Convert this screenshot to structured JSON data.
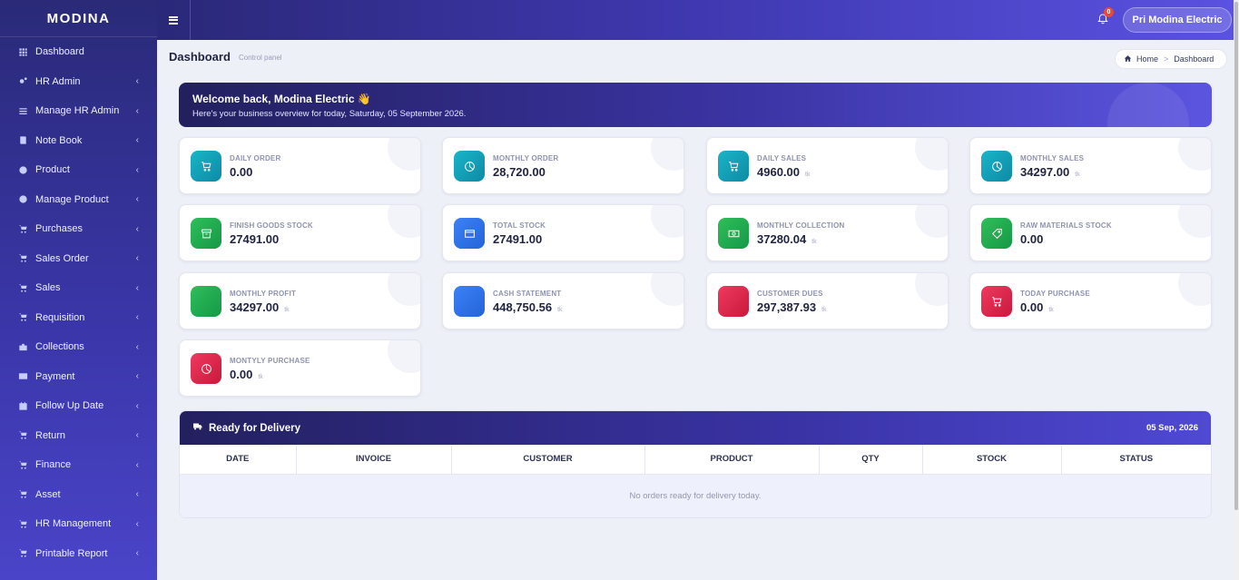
{
  "brand": "MODINA",
  "sidebar": {
    "items": [
      {
        "label": "Dashboard",
        "icon": "grid-icon",
        "chevron": false
      },
      {
        "label": "HR Admin",
        "icon": "cogs-icon",
        "chevron": true
      },
      {
        "label": "Manage HR Admin",
        "icon": "list-icon",
        "chevron": true
      },
      {
        "label": "Note Book",
        "icon": "book-icon",
        "chevron": true
      },
      {
        "label": "Product",
        "icon": "product-icon",
        "chevron": true
      },
      {
        "label": "Manage Product",
        "icon": "product-icon",
        "chevron": true
      },
      {
        "label": "Purchases",
        "icon": "cart-icon",
        "chevron": true
      },
      {
        "label": "Sales Order",
        "icon": "cart-icon",
        "chevron": true
      },
      {
        "label": "Sales",
        "icon": "cart-icon",
        "chevron": true
      },
      {
        "label": "Requisition",
        "icon": "cart-icon",
        "chevron": true
      },
      {
        "label": "Collections",
        "icon": "briefcase-icon",
        "chevron": true
      },
      {
        "label": "Payment",
        "icon": "credit-card-icon",
        "chevron": true
      },
      {
        "label": "Follow Up Date",
        "icon": "calendar-icon",
        "chevron": true
      },
      {
        "label": "Return",
        "icon": "cart-icon",
        "chevron": true
      },
      {
        "label": "Finance",
        "icon": "cart-icon",
        "chevron": true
      },
      {
        "label": "Asset",
        "icon": "cart-icon",
        "chevron": true
      },
      {
        "label": "HR Management",
        "icon": "cart-icon",
        "chevron": true
      },
      {
        "label": "Printable Report",
        "icon": "cart-icon",
        "chevron": true
      }
    ],
    "chevron_glyph": "‹"
  },
  "topbar": {
    "notification_count": "0",
    "user_label": "Pri Modina Electric"
  },
  "header": {
    "title": "Dashboard",
    "subtitle": "Control panel",
    "breadcrumb_home": "Home",
    "breadcrumb_sep": ">",
    "breadcrumb_current": "Dashboard"
  },
  "welcome": {
    "title": "Welcome back, Modina Electric 👋",
    "subtitle": "Here's your business overview for today, Saturday, 05 September 2026."
  },
  "stats": [
    {
      "label": "DAILY ORDER",
      "value": "0.00",
      "unit": "",
      "color": "teal",
      "icon": "cart-icon"
    },
    {
      "label": "MONTHLY ORDER",
      "value": "28,720.00",
      "unit": "",
      "color": "teal",
      "icon": "pie-icon"
    },
    {
      "label": "DAILY SALES",
      "value": "4960.00",
      "unit": "tk",
      "color": "teal",
      "icon": "cart-icon"
    },
    {
      "label": "MONTHLY SALES",
      "value": "34297.00",
      "unit": "tk",
      "color": "teal",
      "icon": "pie-icon"
    },
    {
      "label": "FINISH GOODS STOCK",
      "value": "27491.00",
      "unit": "",
      "color": "green",
      "icon": "archive-icon"
    },
    {
      "label": "TOTAL STOCK",
      "value": "27491.00",
      "unit": "",
      "color": "blue",
      "icon": "box-icon"
    },
    {
      "label": "MONTHLY COLLECTION",
      "value": "37280.04",
      "unit": "tk",
      "color": "green",
      "icon": "money-icon"
    },
    {
      "label": "RAW MATERIALS STOCK",
      "value": "0.00",
      "unit": "",
      "color": "green",
      "icon": "tag-icon"
    },
    {
      "label": "MONTHLY PROFIT",
      "value": "34297.00",
      "unit": "tk",
      "color": "green",
      "icon": ""
    },
    {
      "label": "CASH STATEMENT",
      "value": "448,750.56",
      "unit": "tk",
      "color": "blue",
      "icon": ""
    },
    {
      "label": "CUSTOMER DUES",
      "value": "297,387.93",
      "unit": "tk",
      "color": "red",
      "icon": ""
    },
    {
      "label": "TODAY PURCHASE",
      "value": "0.00",
      "unit": "tk",
      "color": "red",
      "icon": "cart-icon"
    },
    {
      "label": "MONTYLY PURCHASE",
      "value": "0.00",
      "unit": "tk",
      "color": "red",
      "icon": "pie-icon"
    }
  ],
  "delivery": {
    "title": "Ready for Delivery",
    "date": "05 Sep, 2026",
    "columns": [
      "DATE",
      "INVOICE",
      "CUSTOMER",
      "PRODUCT",
      "QTY",
      "STOCK",
      "STATUS"
    ],
    "empty_message": "No orders ready for delivery today."
  }
}
